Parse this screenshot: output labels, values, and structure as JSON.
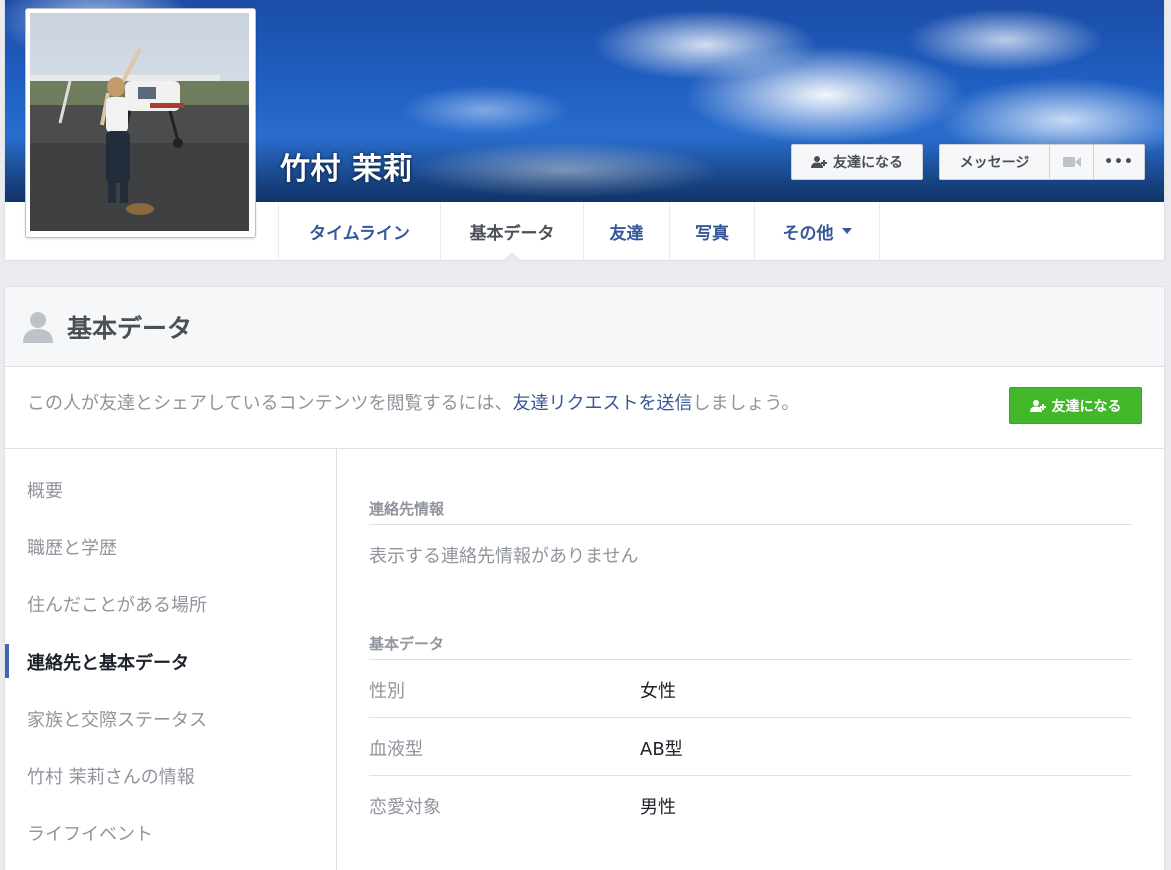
{
  "profile": {
    "name": "竹村 茉莉"
  },
  "cover_actions": {
    "add_friend_label": "友達になる",
    "message_label": "メッセージ",
    "more_label": "•••"
  },
  "tabs": [
    {
      "label": "タイムライン"
    },
    {
      "label": "基本データ"
    },
    {
      "label": "友達"
    },
    {
      "label": "写真"
    },
    {
      "label": "その他"
    }
  ],
  "about": {
    "title": "基本データ",
    "request_prefix": "この人が友達とシェアしているコンテンツを閲覧するには、",
    "request_link": "友達リクエストを送信",
    "request_suffix": "しましょう。",
    "add_friend_label": "友達になる"
  },
  "side_nav": [
    {
      "label": "概要"
    },
    {
      "label": "職歴と学歴"
    },
    {
      "label": "住んだことがある場所"
    },
    {
      "label": "連絡先と基本データ"
    },
    {
      "label": "家族と交際ステータス"
    },
    {
      "label": "竹村 茉莉さんの情報"
    },
    {
      "label": "ライフイベント"
    }
  ],
  "contact": {
    "title": "連絡先情報",
    "empty": "表示する連絡先情報がありません"
  },
  "basic": {
    "title": "基本データ",
    "rows": [
      {
        "label": "性別",
        "value": "女性"
      },
      {
        "label": "血液型",
        "value": "AB型"
      },
      {
        "label": "恋愛対象",
        "value": "男性"
      }
    ]
  },
  "colors": {
    "link": "#365899",
    "green": "#42b72a",
    "active_bar": "#4267b2"
  }
}
